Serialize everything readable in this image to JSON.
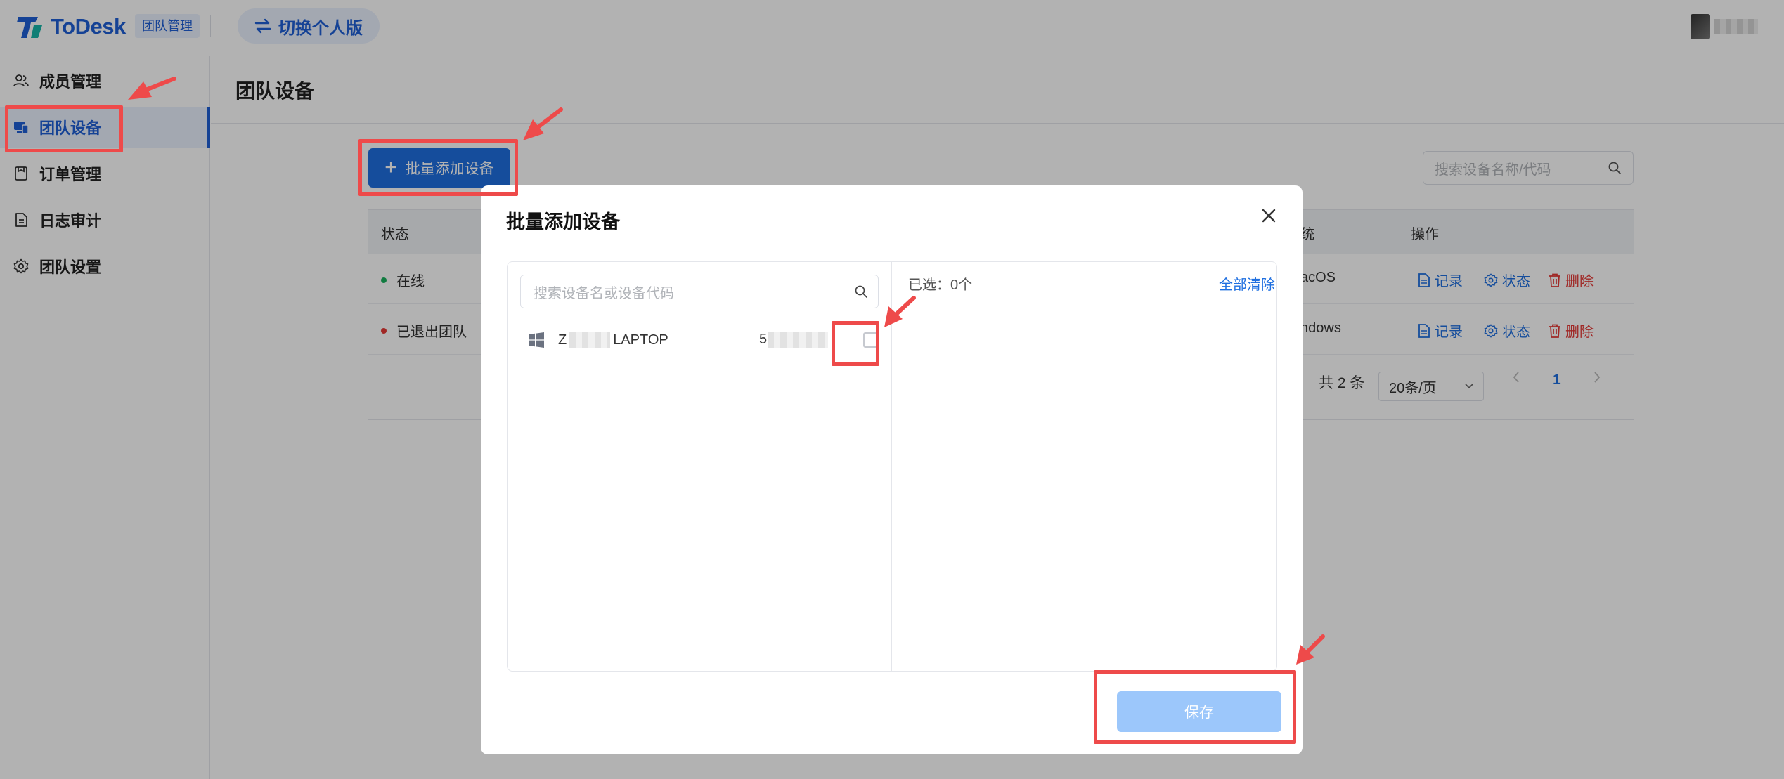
{
  "header": {
    "brand": "ToDesk",
    "team_badge": "团队管理",
    "switch_label": "切换个人版"
  },
  "sidebar": {
    "items": [
      {
        "label": "成员管理",
        "icon": "members-icon"
      },
      {
        "label": "团队设备",
        "icon": "devices-icon"
      },
      {
        "label": "订单管理",
        "icon": "orders-icon"
      },
      {
        "label": "日志审计",
        "icon": "log-icon"
      },
      {
        "label": "团队设置",
        "icon": "gear-icon"
      }
    ],
    "active_index": 1
  },
  "main": {
    "title": "团队设备",
    "batch_add_label": "批量添加设备",
    "search_placeholder": "搜索设备名称/代码",
    "table": {
      "col_status": "状态",
      "col_os_partial": "统",
      "col_actions": "操作",
      "rows": [
        {
          "status": "在线",
          "status_color": "#19b15c",
          "os_partial": "acOS"
        },
        {
          "status": "已退出团队",
          "status_color": "#e53935",
          "os_partial": "ndows"
        }
      ],
      "actions": {
        "record": "记录",
        "status": "状态",
        "delete": "删除"
      }
    },
    "pagination": {
      "total": "共 2 条",
      "page_size": "20条/页",
      "current_page": "1"
    }
  },
  "modal": {
    "title": "批量添加设备",
    "search_placeholder": "搜索设备名或设备代码",
    "device": {
      "name_prefix": "Z",
      "name_suffix": "LAPTOP",
      "code_prefix": "5"
    },
    "selected_label": "已选：0个",
    "clear_all": "全部清除",
    "save_label": "保存"
  }
}
